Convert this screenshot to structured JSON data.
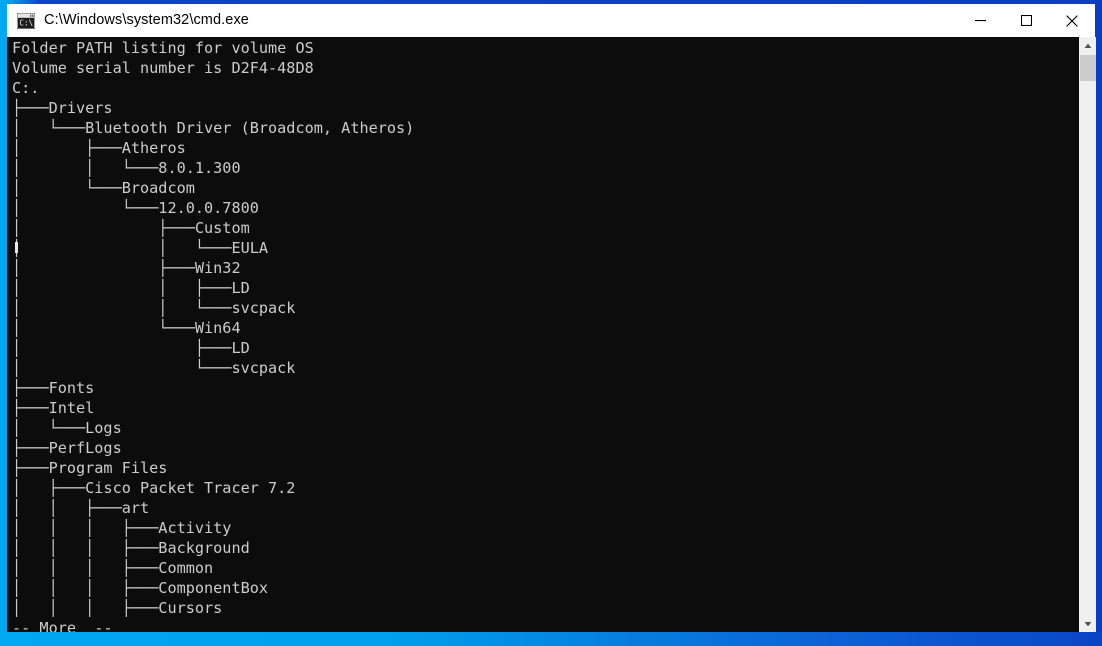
{
  "window": {
    "title": "C:\\Windows\\system32\\cmd.exe",
    "icon": "cmd-console-icon",
    "background_color": "#0c0c0c",
    "text_color": "#cccccc",
    "titlebar_color": "#ffffff"
  },
  "titlebar_buttons": {
    "minimize": "minimize-icon",
    "maximize": "maximize-icon",
    "close": "close-icon"
  },
  "scrollbar": {
    "up_arrow": "scroll-up-arrow-icon",
    "down_arrow": "scroll-down-arrow-icon",
    "thumb": "scrollbar-thumb",
    "track_color": "#f0f0f0",
    "thumb_color": "#cdcdcd"
  },
  "console": {
    "header": [
      "Folder PATH listing for volume OS",
      "Volume serial number is D2F4-48D8",
      "C:."
    ],
    "volume_name": "OS",
    "volume_serial": "D2F4-48D8",
    "root": "C:.",
    "tree_lines": [
      "├───Drivers",
      "│   └───Bluetooth Driver (Broadcom, Atheros)",
      "│       ├───Atheros",
      "│       │   └───8.0.1.300",
      "│       └───Broadcom",
      "│           └───12.0.0.7800",
      "│               ├───Custom",
      "│               │   └───EULA",
      "│               ├───Win32",
      "│               │   ├───LD",
      "│               │   └───svcpack",
      "│               └───Win64",
      "│                   ├───LD",
      "│                   └───svcpack",
      "├───Fonts",
      "├───Intel",
      "│   └───Logs",
      "├───PerfLogs",
      "├───Program Files",
      "│   ├───Cisco Packet Tracer 7.2",
      "│   │   ├───art",
      "│   │   │   ├───Activity",
      "│   │   │   ├───Background",
      "│   │   │   ├───Common",
      "│   │   │   ├───ComponentBox",
      "│   │   │   ├───Cursors"
    ],
    "more_prompt": "-- More  --"
  }
}
